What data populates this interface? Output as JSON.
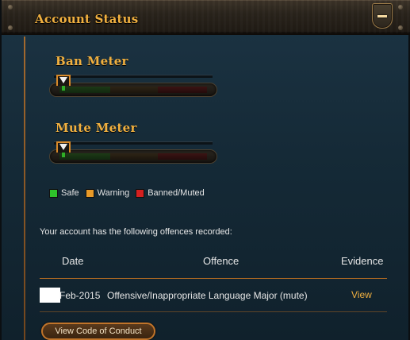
{
  "window": {
    "title": "Account Status"
  },
  "meters": [
    {
      "title": "Ban Meter",
      "level": 0
    },
    {
      "title": "Mute Meter",
      "level": 0
    }
  ],
  "legend": [
    {
      "label": "Safe",
      "color": "#2ec22b"
    },
    {
      "label": "Warning",
      "color": "#e89a28"
    },
    {
      "label": "Banned/Muted",
      "color": "#d42020"
    }
  ],
  "offences": {
    "intro": "Your account has the following offences recorded:",
    "columns": [
      "Date",
      "Offence",
      "Evidence"
    ],
    "rows": [
      {
        "date": "Feb-2015",
        "offence": "Offensive/Inappropriate Language Major (mute)",
        "evidence": "View"
      }
    ]
  },
  "buttons": {
    "code_of_conduct": "View Code of Conduct"
  },
  "icons": {
    "collapse": "minus-icon",
    "marker": "down-triangle-icon"
  }
}
